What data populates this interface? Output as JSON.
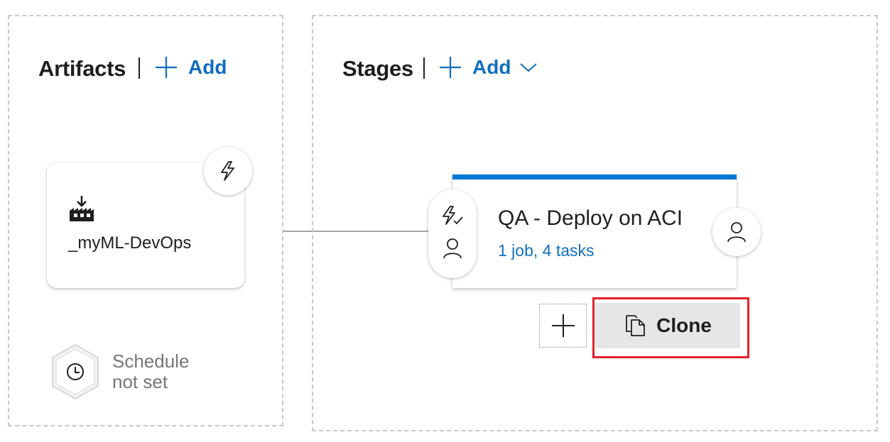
{
  "artifacts": {
    "title": "Artifacts",
    "add_label": "Add",
    "items": [
      {
        "name": "_myML-DevOps",
        "type_icon": "build-icon",
        "trigger_icon": "lightning-icon"
      }
    ],
    "schedule": {
      "line1": "Schedule",
      "line2": "not set",
      "icon": "clock-icon"
    }
  },
  "stages": {
    "title": "Stages",
    "add_label": "Add",
    "items": [
      {
        "name": "QA - Deploy on ACI",
        "summary": "1 job, 4 tasks"
      }
    ],
    "clone_label": "Clone"
  },
  "colors": {
    "accent": "#0078d4",
    "link": "#106ebe",
    "highlight": "#e3202b",
    "muted_text": "#767676"
  }
}
